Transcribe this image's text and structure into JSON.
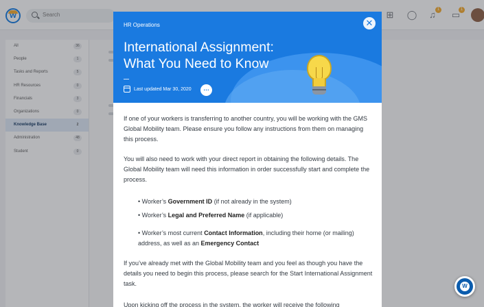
{
  "topbar": {
    "logo_letter": "W",
    "search_placeholder": "Search",
    "bell_badge": "1",
    "inbox_badge": "1"
  },
  "sidebar": {
    "items": [
      {
        "label": "All",
        "count": "36"
      },
      {
        "label": "People",
        "count": "1"
      },
      {
        "label": "Tasks and Reports",
        "count": "5"
      },
      {
        "label": "HR Resources",
        "count": "0"
      },
      {
        "label": "Financials",
        "count": "3"
      },
      {
        "label": "Organizations",
        "count": "0"
      },
      {
        "label": "Knowledge Base",
        "count": "2"
      },
      {
        "label": "Administration",
        "count": "48"
      },
      {
        "label": "Student",
        "count": "0"
      }
    ],
    "active_index": 6
  },
  "article": {
    "kicker": "HR Operations",
    "title": "International Assignment: What You Need to Know",
    "updated": "Last updated Mar 30, 2020",
    "more_label": "…",
    "close_label": "✕",
    "p1": "If one of your workers is transferring to another country, you will be working with the GMS Global Mobility team. Please ensure you follow any instructions from them on managing this process.",
    "p2": "You will also need to work with your direct report in obtaining the following details. The Global Mobility team will need this information in order successfully start and complete the process.",
    "bullets": [
      {
        "pre": "• Worker’s ",
        "bold": "Government ID",
        "post": " (if not already in the system)"
      },
      {
        "pre": "• Worker’s ",
        "bold": "Legal and Preferred Name",
        "post": " (if applicable)"
      },
      {
        "pre": "• Worker’s most current ",
        "bold": "Contact Information",
        "mid": ", including their home (or mailing) address, as well as an ",
        "bold2": "Emergency Contact"
      }
    ],
    "p3": "If you’ve already met with the Global Mobility team and you feel as though you have the details you need to begin this process, please search for the Start International Assignment task.",
    "p4": "Upon kicking off the process in the system, the worker will receive the following"
  },
  "help": {
    "label": "W"
  },
  "colors": {
    "brand": "#1a7ae0",
    "accent": "#f5a623",
    "overlay": "#3c4046"
  }
}
